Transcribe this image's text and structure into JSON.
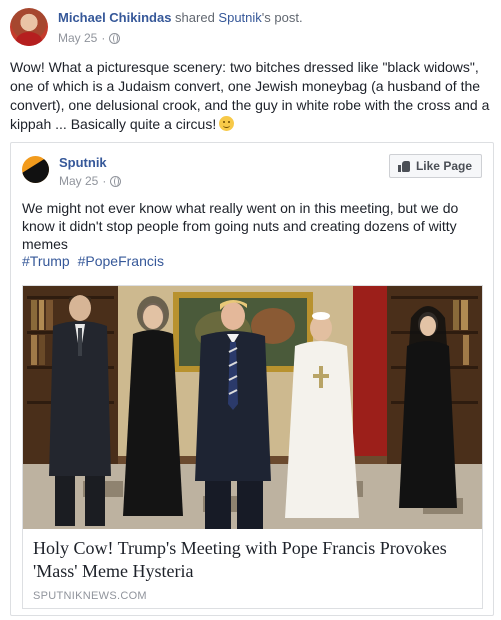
{
  "post": {
    "author": "Michael Chikindas",
    "action": "shared",
    "shared_page": "Sputnik",
    "shared_suffix": "'s post.",
    "date": "May 25",
    "separator": "·",
    "privacy_icon": "globe-icon",
    "text": "Wow! What a picturesque scenery: two bitches dressed like \"black widows\", one of which is a Judaism convert, one Jewish moneybag (a husband of the convert), one delusional crook, and the guy in white robe with the cross and a kippah ... Basically quite a circus!",
    "emoji": "smiling-face-emoji"
  },
  "shared_post": {
    "page_name": "Sputnik",
    "date": "May 25",
    "separator": "·",
    "like_button": "Like Page",
    "text": "We might not ever know what really went on in this meeting, but we do know it didn't stop people from going nuts and creating dozens of witty memes",
    "hashtags": [
      "#Trump",
      "#PopeFrancis"
    ]
  },
  "link_preview": {
    "title": "Holy Cow! Trump's Meeting with Pope Francis Provokes 'Mass' Meme Hysteria",
    "domain": "SPUTNIKNEWS.COM"
  },
  "colors": {
    "link_blue": "#365899",
    "meta_gray": "#90949c",
    "text": "#1d2129",
    "border": "#dddfe2",
    "sputnik_orange": "#f29b1d"
  }
}
